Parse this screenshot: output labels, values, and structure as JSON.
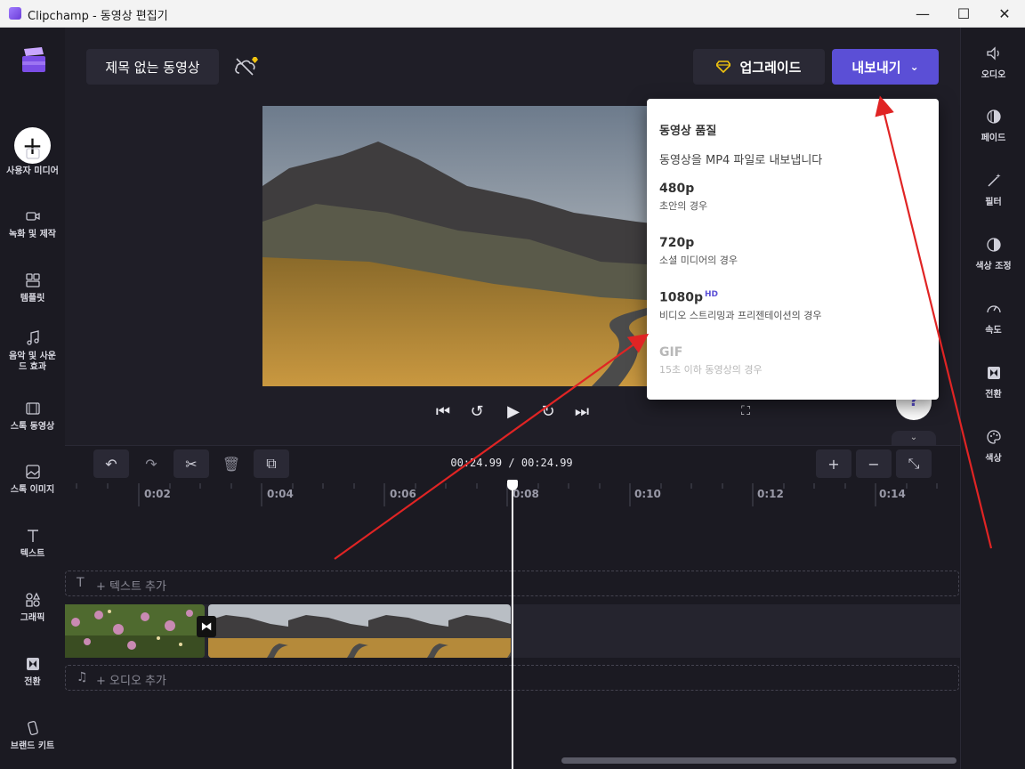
{
  "window": {
    "title": "Clipchamp - 동영상 편집기",
    "minimize_glyph": "—",
    "maximize_glyph": "☐",
    "close_glyph": "✕"
  },
  "header": {
    "project_name": "제목 없는 동영상",
    "upgrade_label": "업그레이드",
    "export_label": "내보내기"
  },
  "left_nav": {
    "items": [
      {
        "label": "사용자 미디어",
        "icon": "folder-icon"
      },
      {
        "label": "녹화 및 제작",
        "icon": "camera-icon"
      },
      {
        "label": "템플릿",
        "icon": "template-icon"
      },
      {
        "label": "음악 및 사운드 효과",
        "icon": "music-icon"
      },
      {
        "label": "스톡 동영상",
        "icon": "film-icon"
      },
      {
        "label": "스톡 이미지",
        "icon": "image-icon"
      },
      {
        "label": "텍스트",
        "icon": "text-icon"
      },
      {
        "label": "그래픽",
        "icon": "shapes-icon"
      },
      {
        "label": "전환",
        "icon": "transition-icon"
      },
      {
        "label": "브랜드 키트",
        "icon": "brand-kit-icon"
      }
    ]
  },
  "right_nav": {
    "items": [
      {
        "label": "오디오",
        "icon": "speaker-icon"
      },
      {
        "label": "페이드",
        "icon": "fade-icon"
      },
      {
        "label": "필터",
        "icon": "magic-wand-icon"
      },
      {
        "label": "색상 조정",
        "icon": "contrast-icon"
      },
      {
        "label": "속도",
        "icon": "speedometer-icon"
      },
      {
        "label": "전환",
        "icon": "transition-icon"
      },
      {
        "label": "색상",
        "icon": "palette-icon"
      }
    ]
  },
  "export_dropdown": {
    "heading": "동영상 품질",
    "description": "동영상을 MP4 파일로 내보냅니다",
    "options": [
      {
        "name": "480p",
        "sub": "초안의 경우",
        "disabled": false
      },
      {
        "name": "720p",
        "sub": "소셜 미디어의 경우",
        "disabled": false
      },
      {
        "name": "1080p",
        "badge": "HD",
        "sub": "비디오 스트리밍과 프리젠테이션의 경우",
        "disabled": false
      },
      {
        "name": "GIF",
        "sub": "15초 이하 동영상의 경우",
        "disabled": true
      }
    ]
  },
  "timeline": {
    "current_time": "00:24.99",
    "separator": "/",
    "total_time": "00:24.99",
    "ticks": [
      "0:02",
      "0:04",
      "0:06",
      "0:08",
      "0:10",
      "0:12",
      "0:14"
    ],
    "text_track_label": "+ 텍스트 추가",
    "audio_track_label": "+ 오디오 추가"
  },
  "colors": {
    "accent": "#5b4fd6",
    "background": "#1b1a22",
    "annotation_arrow": "#e02424"
  }
}
